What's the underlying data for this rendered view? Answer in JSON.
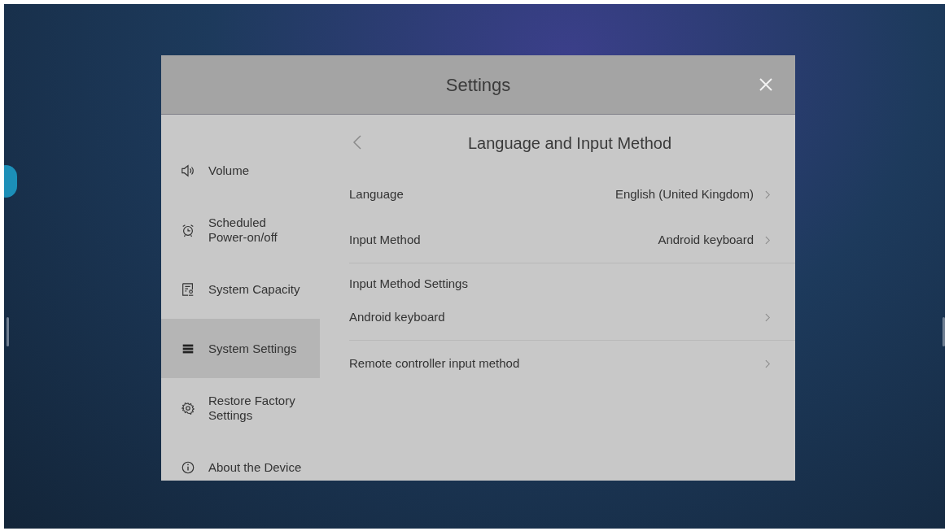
{
  "window": {
    "title": "Settings"
  },
  "sidebar": {
    "items": [
      {
        "kind": "volume",
        "label": "Volume",
        "selected": false
      },
      {
        "kind": "alarm",
        "label": "Scheduled Power-on/off",
        "selected": false
      },
      {
        "kind": "capacity",
        "label": "System Capacity",
        "selected": false
      },
      {
        "kind": "system",
        "label": "System Settings",
        "selected": true
      },
      {
        "kind": "gear",
        "label": "Restore Factory Settings",
        "selected": false
      },
      {
        "kind": "info",
        "label": "About the Device",
        "selected": false
      }
    ]
  },
  "panel": {
    "title": "Language and Input Method",
    "rows": [
      {
        "kind": "option",
        "label": "Language",
        "value": "English (United Kingdom)"
      },
      {
        "kind": "option",
        "label": "Input Method",
        "value": "Android keyboard",
        "divider": true
      },
      {
        "kind": "header",
        "label": "Input Method Settings"
      },
      {
        "kind": "option",
        "label": "Android keyboard",
        "divider": true
      },
      {
        "kind": "option",
        "label": "Remote controller input method"
      }
    ]
  }
}
